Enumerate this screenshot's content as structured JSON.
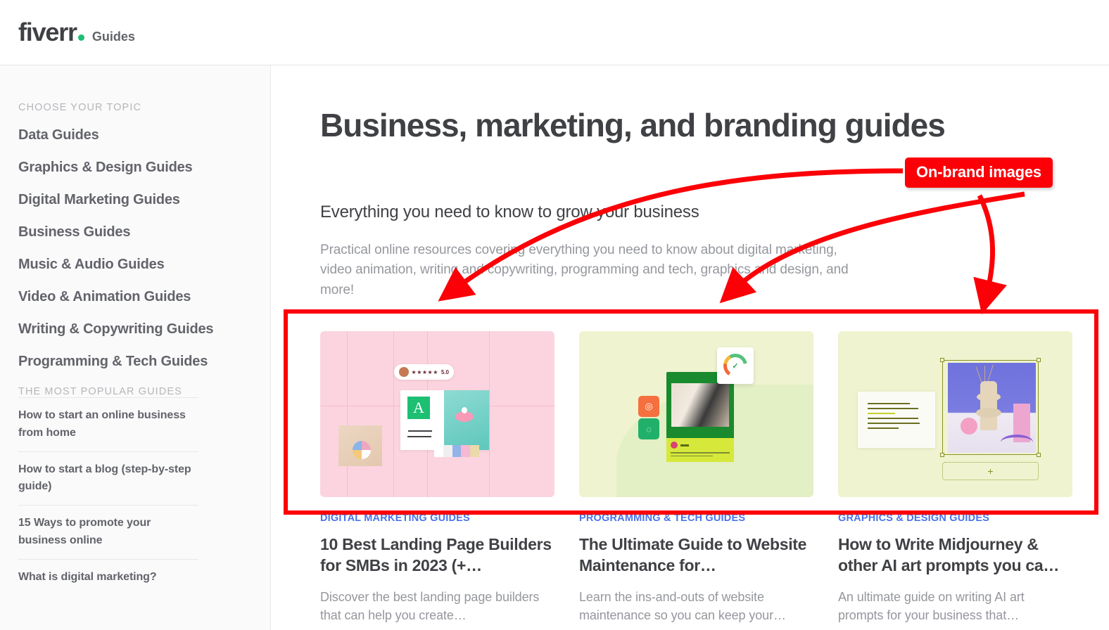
{
  "header": {
    "logo_text": "fiverr",
    "logo_dot": "brand-dot",
    "logo_sub": "Guides"
  },
  "sidebar": {
    "topic_label": "CHOOSE YOUR TOPIC",
    "topics": [
      {
        "label": "Data Guides"
      },
      {
        "label": "Graphics & Design Guides"
      },
      {
        "label": "Digital Marketing Guides"
      },
      {
        "label": "Business Guides"
      },
      {
        "label": "Music & Audio Guides"
      },
      {
        "label": "Video & Animation Guides"
      },
      {
        "label": "Writing & Copywriting Guides"
      },
      {
        "label": "Programming & Tech Guides"
      }
    ],
    "popular_label": "THE MOST POPULAR GUIDES",
    "popular": [
      {
        "label": "How to start an online business from home"
      },
      {
        "label": "How to start a blog (step-by-step guide)"
      },
      {
        "label": "15 Ways to promote your business online"
      },
      {
        "label": "What is digital marketing?"
      }
    ]
  },
  "main": {
    "title": "Business, marketing, and branding guides",
    "subhead": "Everything you need to know to grow your business",
    "para": "Practical online resources covering everything you need to know about digital marketing, video animation, writing and copywriting, programming and tech, graphics and design, and more!",
    "cards": [
      {
        "category": "DIGITAL MARKETING GUIDES",
        "title": "10 Best Landing Page Builders for SMBs in 2023 (+…",
        "desc": "Discover the best landing page builders that can help you create…",
        "thumb_bg": "#fcd4e0",
        "thumb_art": "landing-page-mockup",
        "rating_score": "5.0",
        "rating_stars": "★★★★★",
        "letter_glyph": "A"
      },
      {
        "category": "PROGRAMMING & TECH GUIDES",
        "title": "The Ultimate Guide to Website Maintenance for…",
        "desc": "Learn the ins-and-outs of website maintenance so you can keep your…",
        "thumb_bg": "#eff3cf",
        "thumb_art": "website-maintenance-mockup",
        "gauge_check": "✓",
        "tile_a_glyph": "◎",
        "tile_b_glyph": "◌"
      },
      {
        "category": "GRAPHICS & DESIGN GUIDES",
        "title": "How to Write Midjourney & other AI art prompts you ca…",
        "desc": "An ultimate guide on writing AI art prompts for your business that…",
        "thumb_bg": "#eff3cf",
        "thumb_art": "ai-art-prompt-mockup",
        "add_glyph": "+"
      }
    ]
  },
  "annotation": {
    "label": "On-brand images",
    "color": "#fb0007",
    "highlight_target": "cards-row"
  }
}
